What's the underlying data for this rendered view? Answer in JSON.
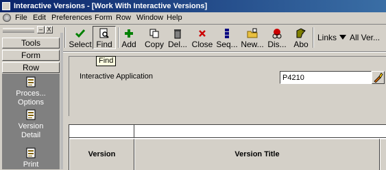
{
  "window": {
    "title": "Interactive Versions - [Work With Interactive Versions]"
  },
  "menu": {
    "items": [
      "File",
      "Edit",
      "Preferences",
      "Form",
      "Row",
      "Window",
      "Help"
    ]
  },
  "sidebar": {
    "controls": [
      "–",
      "X"
    ],
    "buttons": [
      "Tools",
      "Form",
      "Row"
    ],
    "entries": [
      {
        "line1": "Proces...",
        "line2": "Options",
        "icon": "document-list-icon"
      },
      {
        "line1": "Version",
        "line2": "Detail",
        "icon": "document-list-icon"
      },
      {
        "line1": "Print",
        "line2": "",
        "icon": "document-list-icon"
      }
    ]
  },
  "toolbar": {
    "buttons": [
      {
        "label": "Select",
        "icon": "checkmark-icon"
      },
      {
        "label": "Find",
        "icon": "find-icon"
      },
      {
        "label": "Add",
        "icon": "plus-icon"
      },
      {
        "label": "Copy",
        "icon": "copy-icon"
      },
      {
        "label": "Del...",
        "icon": "trash-icon"
      },
      {
        "label": "Close",
        "icon": "close-x-icon"
      },
      {
        "label": "Seq...",
        "icon": "sequence-icon"
      },
      {
        "label": "New...",
        "icon": "new-folder-icon"
      },
      {
        "label": "Dis...",
        "icon": "display-icon"
      },
      {
        "label": "Abo",
        "icon": "about-icon"
      }
    ],
    "links_label": "Links",
    "all_versions_label": "All Ver..."
  },
  "tooltip": {
    "text": "Find"
  },
  "form": {
    "field_label": "Interactive Application",
    "field_value": "P4210"
  },
  "grid": {
    "columns": [
      "Version",
      "Version Title"
    ]
  },
  "colors": {
    "title_bar": "#0a246a",
    "face": "#d4d0c8",
    "sidebar_panel": "#808080",
    "accent_green": "#008000",
    "accent_red": "#cc0000"
  }
}
